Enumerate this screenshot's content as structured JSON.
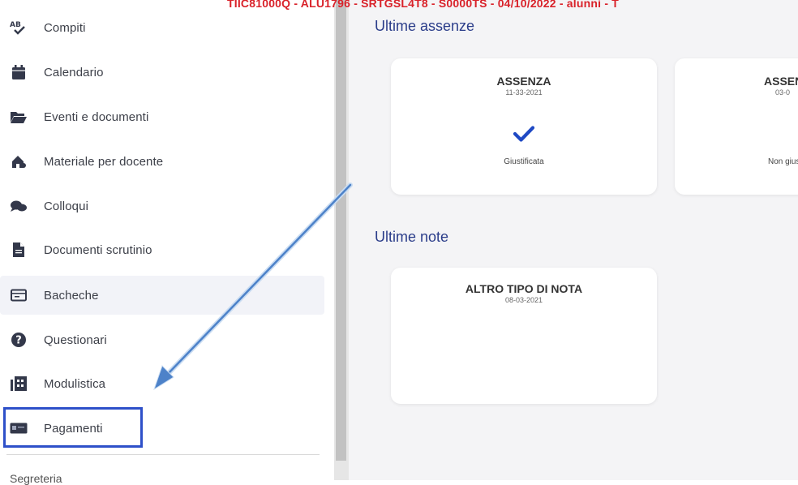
{
  "sidebar": {
    "items": [
      {
        "label": "Compiti",
        "icon": "spellcheck-icon"
      },
      {
        "label": "Calendario",
        "icon": "calendar-icon"
      },
      {
        "label": "Eventi e documenti",
        "icon": "folder-open-icon"
      },
      {
        "label": "Materiale per docente",
        "icon": "house-share-icon"
      },
      {
        "label": "Colloqui",
        "icon": "chat-people-icon"
      },
      {
        "label": "Documenti scrutinio",
        "icon": "document-icon"
      },
      {
        "label": "Bacheche",
        "icon": "board-icon"
      },
      {
        "label": "Questionari",
        "icon": "question-circle-icon"
      },
      {
        "label": "Modulistica",
        "icon": "forms-icon"
      },
      {
        "label": "Pagamenti",
        "icon": "payment-icon"
      }
    ],
    "active_item": "Bacheche",
    "section_label": "Segreteria"
  },
  "main": {
    "banner": "TIIC81000Q - ALU1796 - SRTGSL4T8 - S0000TS - 04/10/2022 - alunni - T",
    "absences": {
      "heading": "Ultime assenze",
      "cards": [
        {
          "title": "ASSENZA",
          "date": "11-33-2021",
          "status": "Giustificata",
          "icon": "check-icon"
        },
        {
          "title": "ASSENZA",
          "date": "03-0",
          "status": "Non giustificata"
        }
      ]
    },
    "notes": {
      "heading": "Ultime note",
      "cards": [
        {
          "title": "ALTRO TIPO DI NOTA",
          "date": "08-03-2021"
        }
      ]
    }
  },
  "colors": {
    "accent": "#2b3d8a",
    "highlight": "#2e50c9",
    "check": "#1f49c4",
    "banner": "#d9222a",
    "arrow": "#4d82c9"
  }
}
